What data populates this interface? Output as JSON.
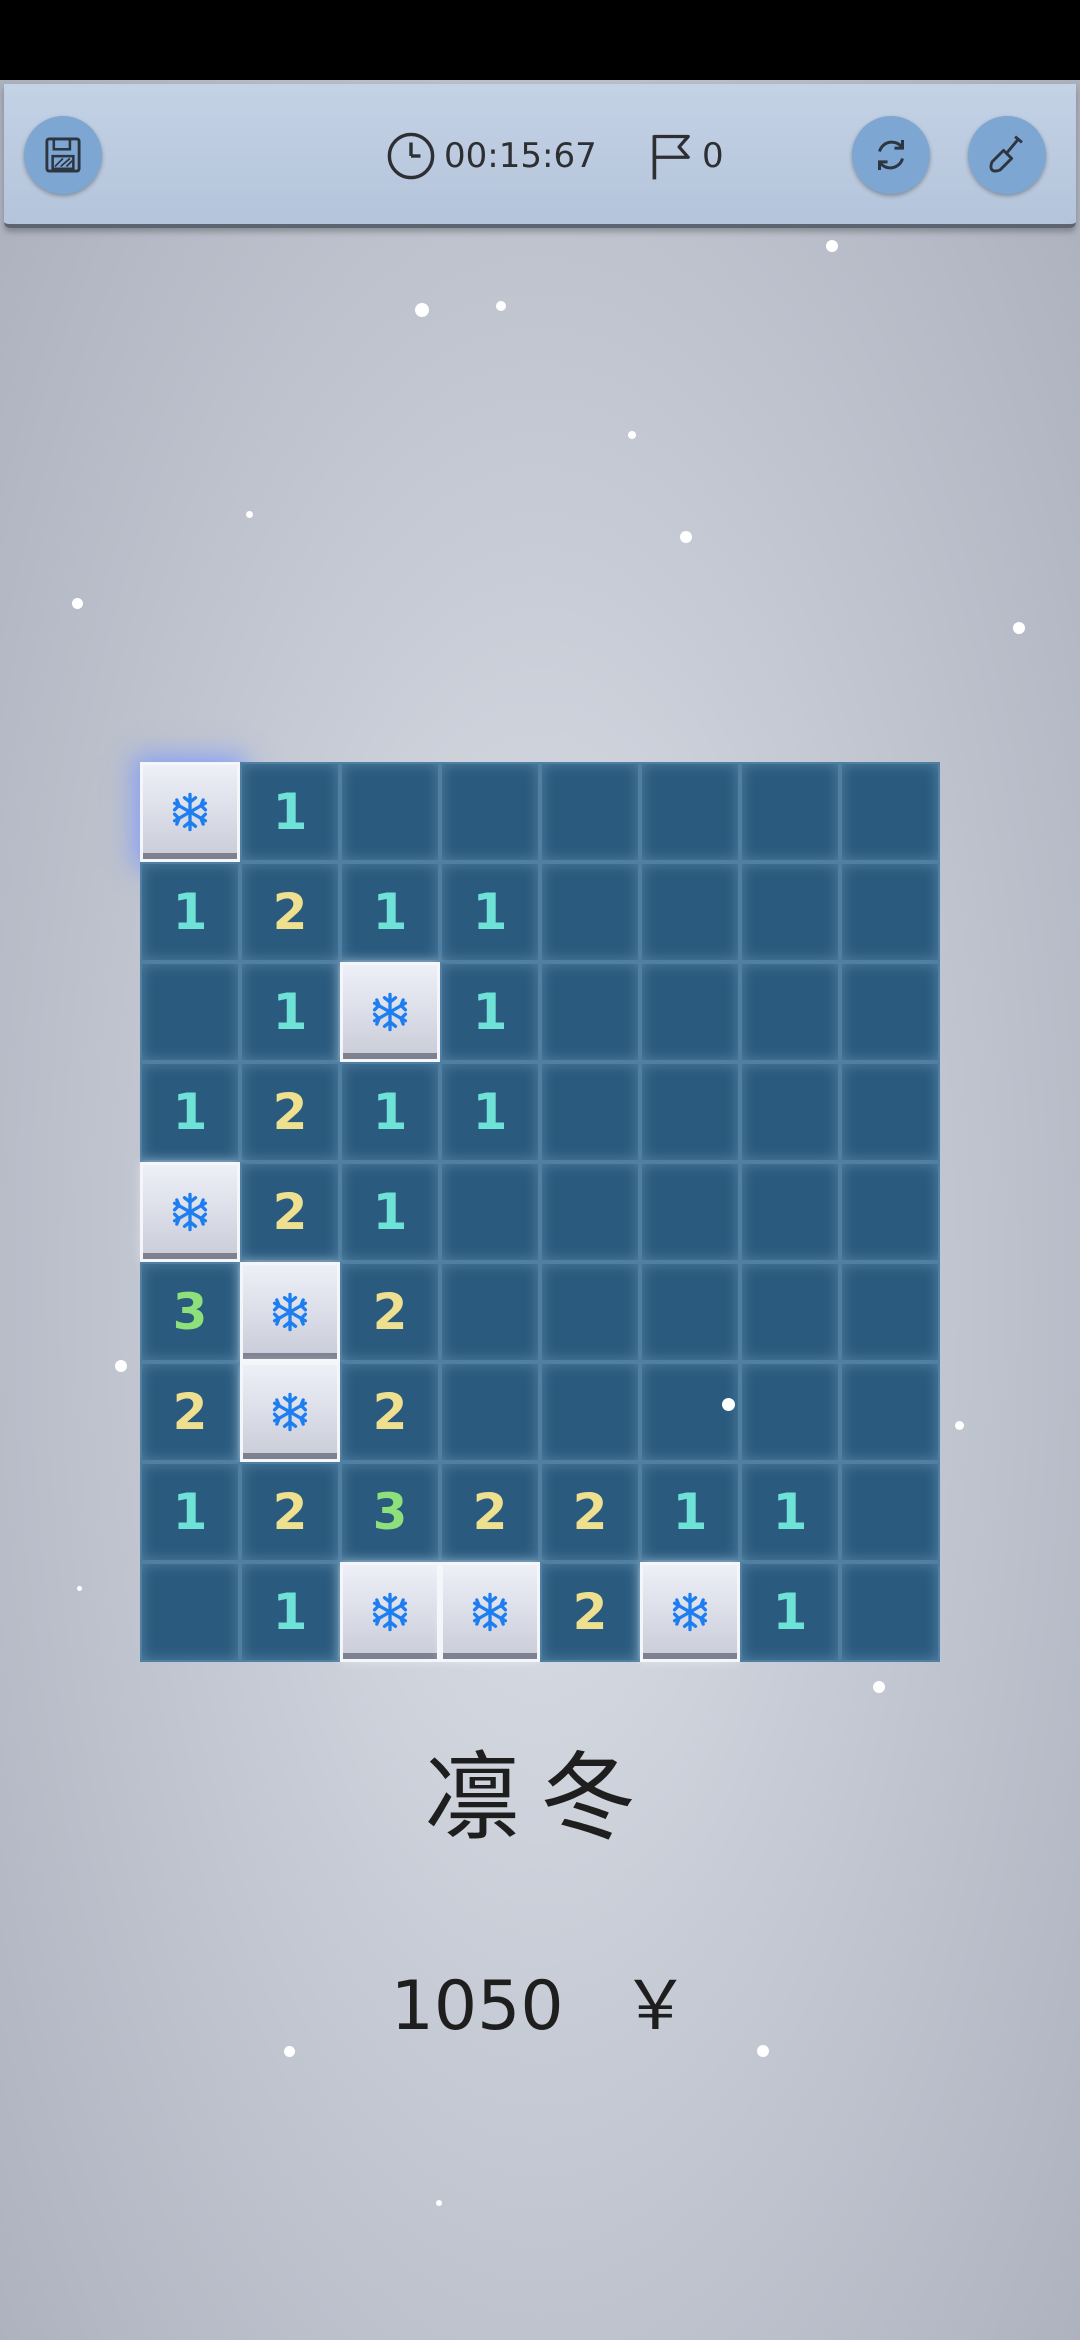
{
  "toolbar": {
    "timer": "00:15:67",
    "flag_count": "0",
    "icons": {
      "save": "save-icon",
      "clock": "clock-icon",
      "flag": "flag-icon",
      "restart": "restart-icon",
      "shovel": "shovel-icon"
    },
    "button_color": "#7ea6d3"
  },
  "board": {
    "columns": 8,
    "rows": 9,
    "cells": [
      [
        "snow",
        "1",
        "",
        "",
        "",
        "",
        "",
        ""
      ],
      [
        "1",
        "2",
        "1",
        "1",
        "",
        "",
        "",
        ""
      ],
      [
        "",
        "1",
        "snow",
        "1",
        "",
        "",
        "",
        ""
      ],
      [
        "1",
        "2",
        "1",
        "1",
        "",
        "",
        "",
        ""
      ],
      [
        "snow",
        "2",
        "1",
        "",
        "",
        "",
        "",
        ""
      ],
      [
        "3",
        "snow",
        "2",
        "",
        "",
        "",
        "",
        ""
      ],
      [
        "2",
        "snow",
        "2",
        "",
        "",
        "",
        "",
        ""
      ],
      [
        "1",
        "2",
        "3",
        "2",
        "2",
        "1",
        "1",
        ""
      ],
      [
        "",
        "1",
        "snow",
        "snow",
        "2",
        "snow",
        "1",
        ""
      ]
    ],
    "colors": {
      "hidden_cell": "#2a5a7e",
      "revealed_cell": "#e6e8f2",
      "number_1": "#6fe2d8",
      "number_2": "#eee08f",
      "number_3": "#8ee07a",
      "snowflake": "#1e7ef0"
    }
  },
  "title": "凛冬",
  "score": {
    "value": "1050",
    "currency": "￥"
  }
}
